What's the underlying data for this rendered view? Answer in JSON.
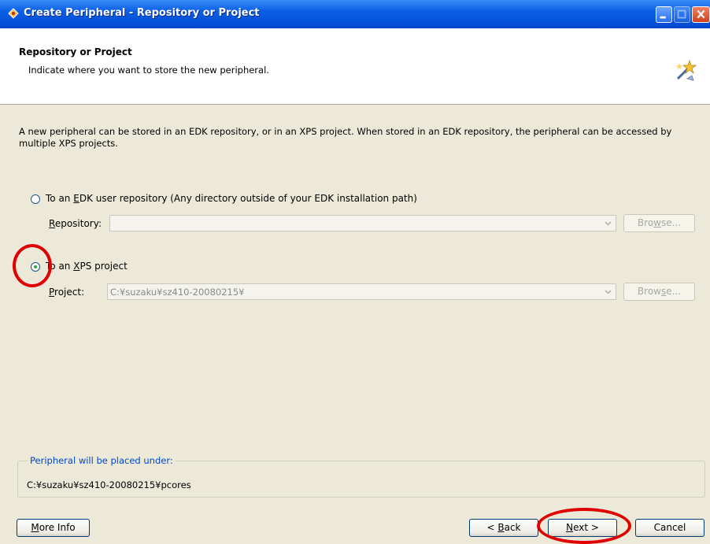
{
  "window": {
    "title": "Create Peripheral - Repository or Project"
  },
  "header": {
    "title": "Repository or Project",
    "subtitle": "Indicate where you want to store the new peripheral."
  },
  "description": "A new peripheral can be stored in an EDK repository, or in an XPS project. When stored in an EDK repository, the peripheral can be accessed by multiple XPS projects.",
  "option_repository": {
    "label_pre": "To an ",
    "label_key": "E",
    "label_post": "DK user repository (Any directory outside of your EDK installation path)",
    "selected": false,
    "field_label_key": "R",
    "field_label_rest": "epository:",
    "value": "",
    "browse_pre": "Bro",
    "browse_key": "w",
    "browse_post": "se..."
  },
  "option_project": {
    "label_pre": "To an ",
    "label_key": "X",
    "label_post": "PS project",
    "selected": true,
    "field_label_key": "P",
    "field_label_rest": "roject:",
    "value": "C:¥suzaku¥sz410-20080215¥",
    "browse_pre": "Brow",
    "browse_key": "s",
    "browse_post": "e..."
  },
  "placement": {
    "legend": "Peripheral will be placed under:",
    "path": "C:¥suzaku¥sz410-20080215¥pcores"
  },
  "buttons": {
    "more_info_key": "M",
    "more_info_rest": "ore Info",
    "back_pre": "< ",
    "back_key": "B",
    "back_rest": "ack",
    "next_key": "N",
    "next_rest": "ext >",
    "cancel": "Cancel"
  },
  "colors": {
    "titlebar": "#0a5ee6",
    "dialog_bg": "#ece9d8",
    "callout": "#e00000",
    "legend_text": "#0046d5"
  }
}
